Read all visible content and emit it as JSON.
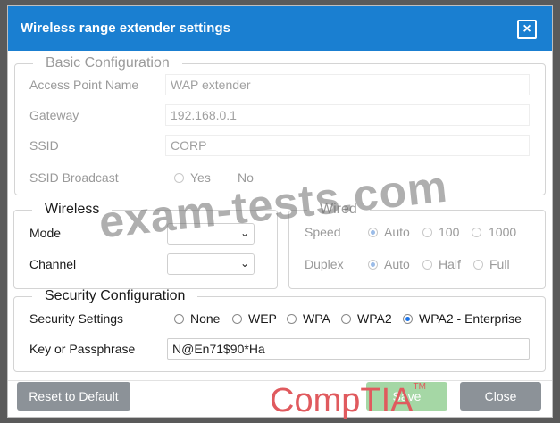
{
  "window": {
    "title": "Wireless range extender settings",
    "close_icon": "×"
  },
  "basic": {
    "legend": "Basic Configuration",
    "ap_name_label": "Access Point Name",
    "ap_name_value": "WAP extender",
    "gateway_label": "Gateway",
    "gateway_value": "192.168.0.1",
    "ssid_label": "SSID",
    "ssid_value": "CORP",
    "ssid_broadcast_label": "SSID Broadcast",
    "broadcast_yes": "Yes",
    "broadcast_no": "No"
  },
  "wireless": {
    "legend": "Wireless",
    "mode_label": "Mode",
    "mode_value": "",
    "channel_label": "Channel",
    "channel_value": ""
  },
  "wired": {
    "legend": "Wired",
    "speed_label": "Speed",
    "speed_options": [
      "Auto",
      "100",
      "1000"
    ],
    "speed_selected": "Auto",
    "duplex_label": "Duplex",
    "duplex_options": [
      "Auto",
      "Half",
      "Full"
    ],
    "duplex_selected": "Auto"
  },
  "security": {
    "legend": "Security Configuration",
    "settings_label": "Security Settings",
    "options": [
      "None",
      "WEP",
      "WPA",
      "WPA2",
      "WPA2 - Enterprise"
    ],
    "selected": "WPA2 - Enterprise",
    "passphrase_label": "Key or Passphrase",
    "passphrase_value": "N@En71$90*Ha"
  },
  "buttons": {
    "reset": "Reset to Default",
    "save": "Save",
    "close": "Close"
  },
  "watermark": "exam-tests.com",
  "logo": {
    "text": "CompTIA",
    "tm": "TM"
  },
  "colors": {
    "titlebar": "#1a7fd1",
    "radio_selected": "#1a73e8",
    "button_gray": "#8c9298",
    "button_green": "#5cb85c",
    "logo": "#e05a5e"
  }
}
